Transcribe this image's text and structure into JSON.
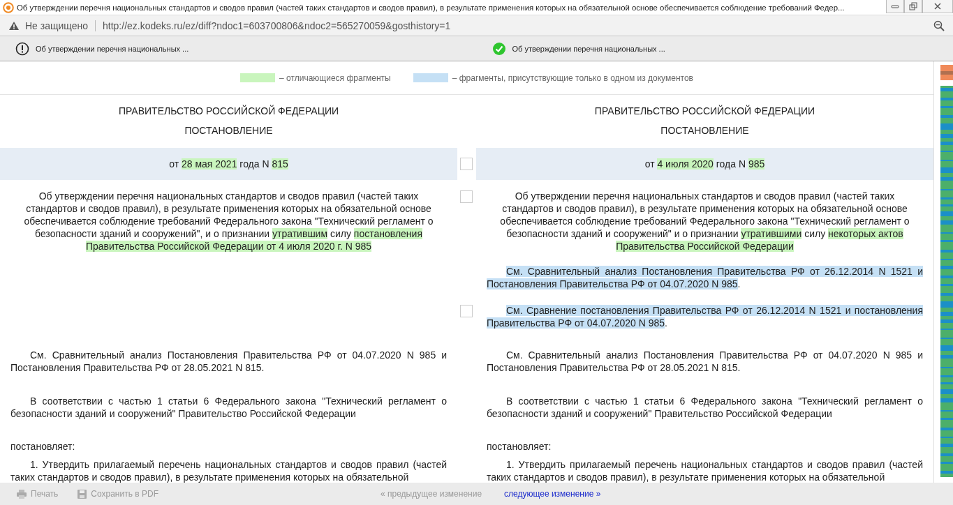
{
  "window": {
    "title": "Об утверждении перечня национальных стандартов и сводов правил (частей таких стандартов и сводов правил), в результате применения которых на обязательной основе обеспечивается соблюдение требований Федер..."
  },
  "address_bar": {
    "security": "Не защищено",
    "url": "http://ez.kodeks.ru/ez/diff?ndoc1=603700806&ndoc2=565270059&gosthistory=1"
  },
  "documents": [
    {
      "kind": "warning",
      "title": "Об утверждении перечня национальных ..."
    },
    {
      "kind": "ok",
      "title": "Об утверждении перечня национальных ..."
    }
  ],
  "legend": [
    {
      "kind": "diff",
      "label": "– отличающиеся фрагменты"
    },
    {
      "kind": "unique",
      "label": "– фрагменты, присутствующие только в одном из документов"
    }
  ],
  "rows": [
    {
      "marker": false,
      "band": false,
      "left": [
        {
          "kind": "center",
          "segments": [
            {
              "text": "ПРАВИТЕЛЬСТВО РОССИЙСКОЙ ФЕДЕРАЦИИ"
            }
          ]
        }
      ],
      "right": [
        {
          "kind": "center",
          "segments": [
            {
              "text": "ПРАВИТЕЛЬСТВО РОССИЙСКОЙ ФЕДЕРАЦИИ"
            }
          ]
        }
      ]
    },
    {
      "marker": false,
      "band": false,
      "left": [
        {
          "kind": "center",
          "segments": [
            {
              "text": "ПОСТАНОВЛЕНИЕ"
            }
          ]
        }
      ],
      "right": [
        {
          "kind": "center",
          "segments": [
            {
              "text": "ПОСТАНОВЛЕНИЕ"
            }
          ]
        }
      ]
    },
    {
      "marker": true,
      "checked": false,
      "band": true,
      "left": [
        {
          "kind": "center",
          "segments": [
            {
              "text": "от "
            },
            {
              "text": "28 мая 2021",
              "kind": "diff"
            },
            {
              "text": " года N "
            },
            {
              "text": "815",
              "kind": "diff"
            }
          ]
        }
      ],
      "right": [
        {
          "kind": "center",
          "segments": [
            {
              "text": "от "
            },
            {
              "text": "4 июля 2020",
              "kind": "diff"
            },
            {
              "text": " года N "
            },
            {
              "text": "985",
              "kind": "diff"
            }
          ]
        }
      ]
    },
    {
      "marker": true,
      "checked": false,
      "band": false,
      "left": [
        {
          "kind": "center",
          "segments": [
            {
              "text": "Об утверждении перечня национальных стандартов и сводов правил (частей таких стандартов и сводов правил), в результате применения которых на обязательной основе обеспечивается соблюдение требований Федерального закона \"Технический регламент о безопасности зданий и сооружений\", и о признании "
            },
            {
              "text": "утратившим",
              "kind": "diff"
            },
            {
              "text": " силу "
            },
            {
              "text": "постановления Правительства Российской Федерации от 4 июля 2020 г. N 985",
              "kind": "diff"
            }
          ]
        }
      ],
      "right": [
        {
          "kind": "center",
          "segments": [
            {
              "text": "Об утверждении перечня национальных стандартов и сводов правил (частей таких стандартов и сводов правил), в результате применения которых на обязательной основе обеспечивается соблюдение требований Федерального закона \"Технический регламент о безопасности зданий и сооружений\" и о признании "
            },
            {
              "text": "утратившими",
              "kind": "diff"
            },
            {
              "text": " силу "
            },
            {
              "text": "некоторых актов Правительства Российской Федерации",
              "kind": "diff"
            }
          ]
        },
        {
          "kind": "justify",
          "segments": [
            {
              "text": "См. Сравнительный анализ Постановления Правительства РФ от 26.12.2014 N 1521 и Постановления Правительства РФ от 04.07.2020 N 985",
              "kind": "unique"
            },
            {
              "text": "."
            }
          ]
        }
      ]
    },
    {
      "marker": true,
      "checked": false,
      "band": false,
      "left": [],
      "right": [
        {
          "kind": "justify",
          "segments": [
            {
              "text": "См. Сравнение постановления Правительства РФ от 26.12.2014 N 1521 и постановления Правительства РФ от 04.07.2020 N 985",
              "kind": "unique"
            },
            {
              "text": "."
            }
          ]
        }
      ]
    },
    {
      "marker": false,
      "band": false,
      "left": [
        {
          "kind": "justify",
          "segments": [
            {
              "text": "См. Сравнительный анализ Постановления Правительства РФ от 04.07.2020 N 985 и Постановления Правительства РФ от 28.05.2021 N 815."
            }
          ]
        }
      ],
      "right": [
        {
          "kind": "justify",
          "segments": [
            {
              "text": "См. Сравнительный анализ Постановления Правительства РФ от 04.07.2020 N 985 и Постановления Правительства РФ от 28.05.2021 N 815."
            }
          ]
        }
      ]
    },
    {
      "marker": false,
      "band": false,
      "left": [
        {
          "kind": "justify",
          "segments": [
            {
              "text": "В соответствии с частью 1 статьи 6 Федерального закона \"Технический регламент о безопасности зданий и сооружений\" Правительство Российской Федерации"
            }
          ]
        }
      ],
      "right": [
        {
          "kind": "justify",
          "segments": [
            {
              "text": "В соответствии с частью 1 статьи 6 Федерального закона \"Технический регламент о безопасности зданий и сооружений\" Правительство Российской Федерации"
            }
          ]
        }
      ]
    },
    {
      "marker": false,
      "band": false,
      "left": [
        {
          "kind": "plain",
          "segments": [
            {
              "text": "постановляет:"
            }
          ]
        }
      ],
      "right": [
        {
          "kind": "plain",
          "segments": [
            {
              "text": "постановляет:"
            }
          ]
        }
      ]
    },
    {
      "marker": false,
      "band": false,
      "left": [
        {
          "kind": "justify",
          "segments": [
            {
              "text": "1. Утвердить прилагаемый перечень национальных стандартов и сводов правил (частей таких стандартов и сводов правил), в результате применения которых на обязательной"
            }
          ]
        }
      ],
      "right": [
        {
          "kind": "justify",
          "segments": [
            {
              "text": "1. Утвердить прилагаемый перечень национальных стандартов и сводов правил (частей таких стандартов и сводов правил), в результате применения которых на обязательной"
            }
          ]
        }
      ]
    }
  ],
  "footer": [
    {
      "kind": "print",
      "label": "Печать",
      "disabled": true
    },
    {
      "kind": "pdf",
      "label": "Сохранить в PDF",
      "disabled": true
    },
    {
      "kind": "prev",
      "label": "« предыдущее изменение",
      "disabled": true
    },
    {
      "kind": "next",
      "label": "следующее изменение »",
      "disabled": false
    }
  ]
}
